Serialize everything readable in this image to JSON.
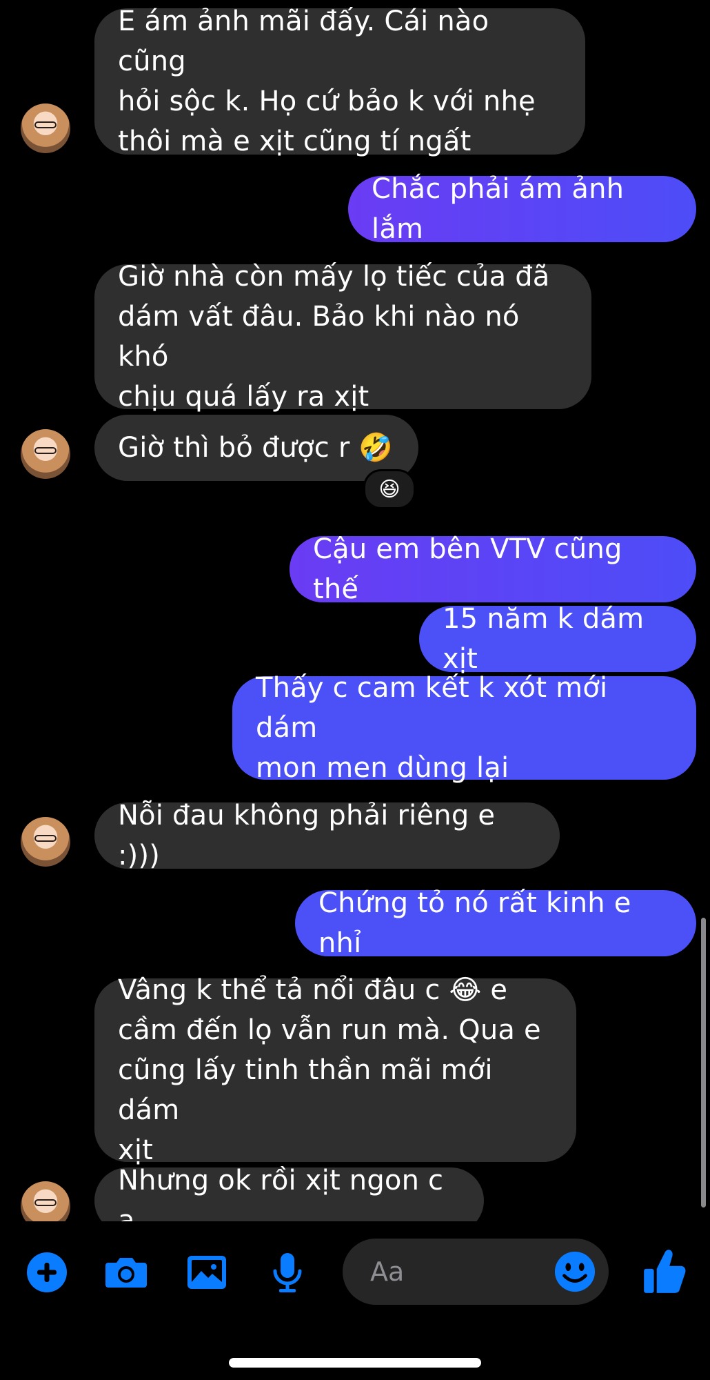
{
  "accent_color": "#0a7cff",
  "messages": [
    {
      "from": "them",
      "text": "E ám ảnh mãi đấy. Cái nào cũng\nhỏi sộc k. Họ cứ bảo k với nhẹ\nthôi mà e xịt cũng tí ngất"
    },
    {
      "from": "me",
      "text": "Chắc phải ám ảnh lắm"
    },
    {
      "from": "them",
      "text": "Giờ nhà còn mấy lọ tiếc của đã\ndám vất đâu. Bảo khi nào nó khó\nchịu quá lấy ra xịt"
    },
    {
      "from": "them",
      "text": "Giờ thì bỏ được r 🤣",
      "reaction": "😆"
    },
    {
      "from": "me",
      "text": "Cậu em bên VTV cũng thế"
    },
    {
      "from": "me",
      "text": "15 năm k dám xịt"
    },
    {
      "from": "me",
      "text": "Thấy c cam kết k xót mới dám\nmon men dùng lại"
    },
    {
      "from": "them",
      "text": "Nỗi đau không phải riêng e :)))"
    },
    {
      "from": "me",
      "text": "Chứng tỏ nó rất kinh e nhỉ"
    },
    {
      "from": "them",
      "text": "Vâng k thể tả nổi đâu c 😂 e\ncầm đến lọ vẫn run mà. Qua e\ncũng lấy tinh thần mãi mới dám\nxịt"
    },
    {
      "from": "them",
      "text": "Nhưng ok rồi xịt ngon c ạ"
    }
  ],
  "composer": {
    "placeholder": "Aa",
    "icons": [
      "plus-icon",
      "camera-icon",
      "image-icon",
      "microphone-icon",
      "emoji-icon",
      "thumbs-up-icon"
    ]
  }
}
